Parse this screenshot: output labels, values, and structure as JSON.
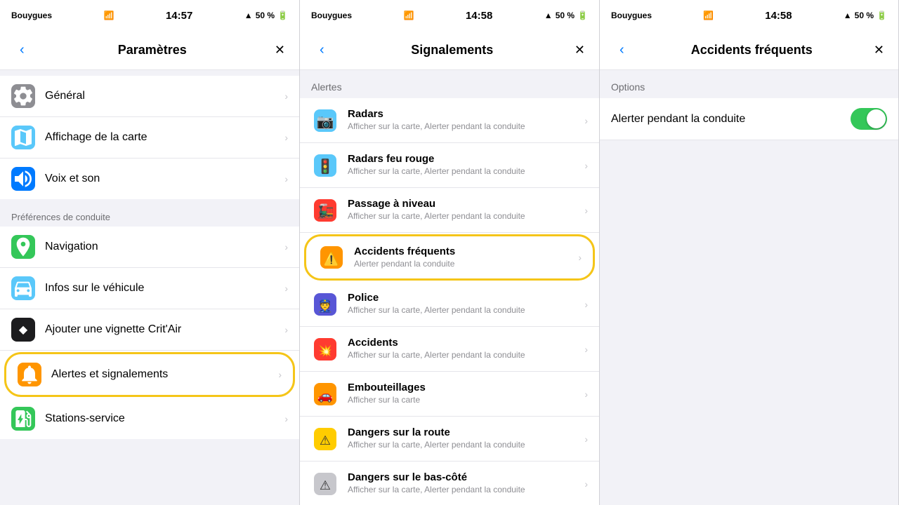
{
  "panels": [
    {
      "id": "parametres",
      "statusBar": {
        "carrier": "Bouygues",
        "wifi": true,
        "time": "14:57",
        "location": true,
        "battery": "50 %"
      },
      "navTitle": "Paramètres",
      "backLabel": "<",
      "closeLabel": "×",
      "sections": [
        {
          "header": null,
          "items": [
            {
              "id": "general",
              "icon": "gear",
              "iconColor": "#8e8e93",
              "title": "Général",
              "subtitle": null
            },
            {
              "id": "map",
              "icon": "map",
              "iconColor": "#5ac8fa",
              "title": "Affichage de la carte",
              "subtitle": null
            },
            {
              "id": "voice",
              "icon": "voice",
              "iconColor": "#007aff",
              "title": "Voix et son",
              "subtitle": null
            }
          ]
        },
        {
          "header": "Préférences de conduite",
          "items": [
            {
              "id": "navigation",
              "icon": "nav",
              "iconColor": "#34c759",
              "title": "Navigation",
              "subtitle": null
            },
            {
              "id": "vehicle",
              "icon": "vehicle",
              "iconColor": "#5ac8fa",
              "title": "Infos sur le véhicule",
              "subtitle": null
            },
            {
              "id": "vignette",
              "icon": "vignette",
              "iconColor": "#1c1c1e",
              "title": "Ajouter une vignette Crit'Air",
              "subtitle": null
            },
            {
              "id": "alerts",
              "icon": "alerts",
              "iconColor": "#ff9500",
              "title": "Alertes et signalements",
              "subtitle": null,
              "circled": true
            },
            {
              "id": "stations",
              "icon": "stations",
              "iconColor": "#34c759",
              "title": "Stations-service",
              "subtitle": null
            }
          ]
        }
      ]
    },
    {
      "id": "signalements",
      "statusBar": {
        "carrier": "Bouygues",
        "wifi": true,
        "time": "14:58",
        "location": true,
        "battery": "50 %"
      },
      "navTitle": "Signalements",
      "backLabel": "<",
      "closeLabel": "×",
      "alertsHeader": "Alertes",
      "items": [
        {
          "id": "radars",
          "title": "Radars",
          "subtitle": "Afficher sur la carte, Alerter pendant la conduite",
          "highlighted": false
        },
        {
          "id": "radars-feu",
          "title": "Radars feu rouge",
          "subtitle": "Afficher sur la carte, Alerter pendant la conduite",
          "highlighted": false
        },
        {
          "id": "passage",
          "title": "Passage à niveau",
          "subtitle": "Afficher sur la carte, Alerter pendant la conduite",
          "highlighted": false
        },
        {
          "id": "accidents-freq",
          "title": "Accidents fréquents",
          "subtitle": "Alerter pendant la conduite",
          "highlighted": true
        },
        {
          "id": "police",
          "title": "Police",
          "subtitle": "Afficher sur la carte, Alerter pendant la conduite",
          "highlighted": false
        },
        {
          "id": "accidents",
          "title": "Accidents",
          "subtitle": "Afficher sur la carte, Alerter pendant la conduite",
          "highlighted": false
        },
        {
          "id": "embouteillages",
          "title": "Embouteillages",
          "subtitle": "Afficher sur la carte",
          "highlighted": false
        },
        {
          "id": "dangers-route",
          "title": "Dangers sur la route",
          "subtitle": "Afficher sur la carte, Alerter pendant la conduite",
          "highlighted": false
        },
        {
          "id": "dangers-bas",
          "title": "Dangers sur le bas-côté",
          "subtitle": "Afficher sur la carte, Alerter pendant la conduite",
          "highlighted": false
        }
      ]
    },
    {
      "id": "accidents-frequents",
      "statusBar": {
        "carrier": "Bouygues",
        "wifi": true,
        "time": "14:58",
        "location": true,
        "battery": "50 %"
      },
      "navTitle": "Accidents fréquents",
      "backLabel": "<",
      "closeLabel": "×",
      "optionsHeader": "Options",
      "options": [
        {
          "id": "alerter",
          "label": "Alerter pendant la conduite",
          "toggle": true
        }
      ]
    }
  ]
}
